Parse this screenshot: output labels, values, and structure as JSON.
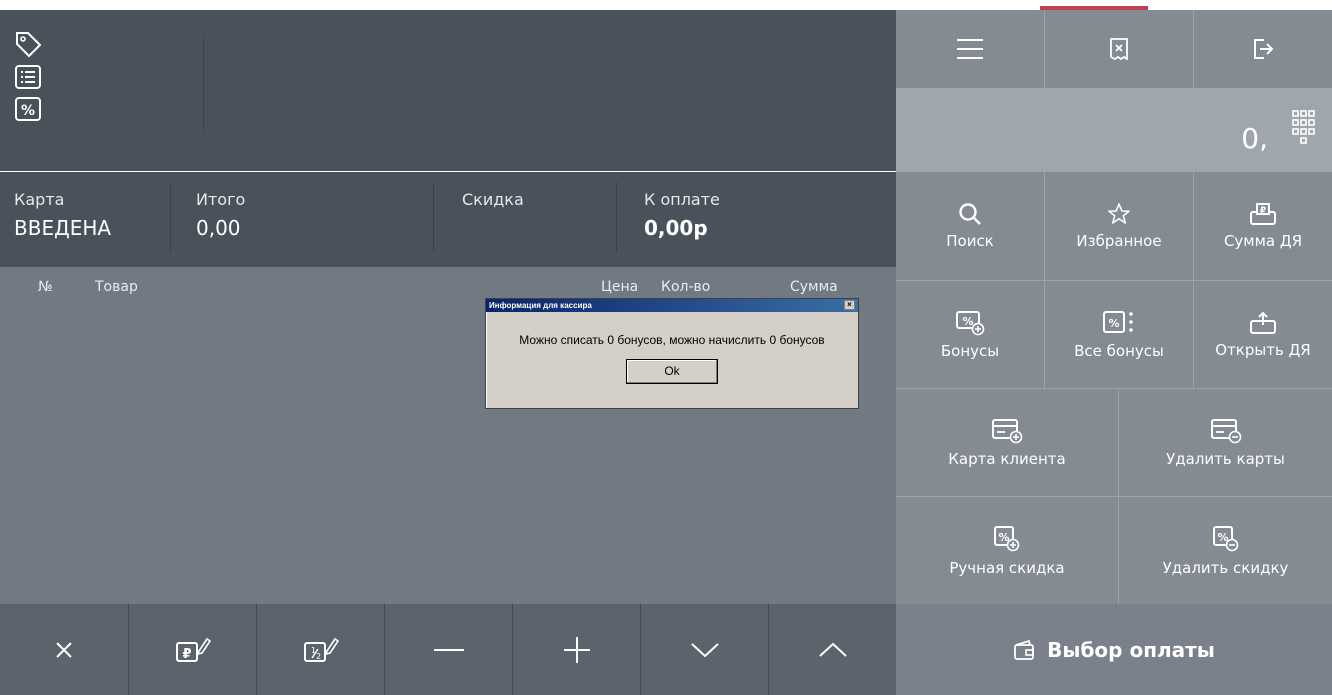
{
  "totals": {
    "card_label": "Карта",
    "card_value": "ВВЕДЕНА",
    "total_label": "Итого",
    "total_value": "0,00",
    "discount_label": "Скидка",
    "topay_label": "К оплате",
    "topay_value": "0,00р"
  },
  "list": {
    "col_num": "№",
    "col_item": "Товар",
    "col_price": "Цена",
    "col_qty": "Кол-во",
    "col_sum": "Сумма"
  },
  "display": {
    "value": "0,"
  },
  "right_buttons": {
    "search": "Поиск",
    "favorites": "Избранное",
    "sum_dya": "Сумма ДЯ",
    "bonuses": "Бонусы",
    "all_bonuses": "Все бонусы",
    "open_dya": "Открыть ДЯ",
    "client_card": "Карта клиента",
    "delete_cards": "Удалить карты",
    "manual_discount": "Ручная скидка",
    "delete_discount": "Удалить скидку"
  },
  "payment": {
    "label": "Выбор оплаты"
  },
  "dialog": {
    "title": "Информация для кассира",
    "close": "×",
    "message": "Можно списать 0 бонусов, можно начислить 0 бонусов",
    "ok": "Ok"
  },
  "icons": {
    "tag": "tag-icon",
    "list": "list-icon",
    "percent": "percent-icon",
    "menu": "menu-icon",
    "receipt": "receipt-icon",
    "logout": "logout-icon",
    "numpad": "numpad-icon",
    "wallet": "wallet-icon"
  },
  "colors": {
    "dark_panel": "#49525b",
    "list_bg": "#717982",
    "right_bg": "#848b93",
    "accent": "#c04050"
  }
}
